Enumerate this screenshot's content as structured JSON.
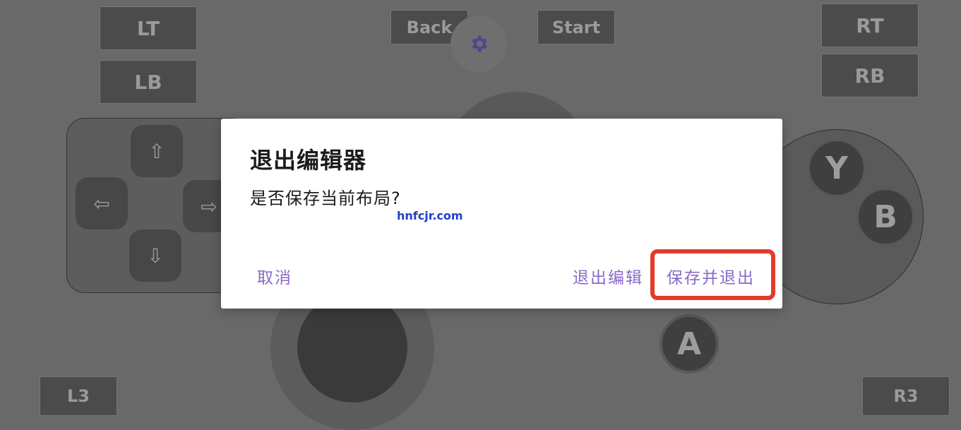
{
  "controller": {
    "lt": "LT",
    "lb": "LB",
    "rt": "RT",
    "rb": "RB",
    "back": "Back",
    "start": "Start",
    "l3": "L3",
    "r3": "R3",
    "dpad": {
      "up": "⇧",
      "down": "⇩",
      "left": "⇦",
      "right": "⇨"
    },
    "face": {
      "y": "Y",
      "b": "B",
      "a": "A"
    },
    "settings_icon": "gear-icon"
  },
  "dialog": {
    "title": "退出编辑器",
    "message": "是否保存当前布局?",
    "cancel_label": "取消",
    "exit_label": "退出编辑",
    "save_exit_label": "保存并退出"
  },
  "watermark": "hnfcjr.com",
  "colors": {
    "accent": "#8b68c9",
    "highlight": "#e53a2a",
    "scrim": "#696969"
  }
}
